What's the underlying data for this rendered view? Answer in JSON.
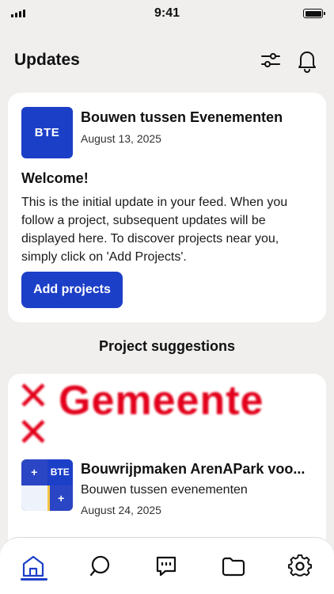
{
  "status_bar": {
    "time": "9:41"
  },
  "header": {
    "title": "Updates",
    "filter_icon": "sliders-icon",
    "bell_icon": "bell-icon"
  },
  "update": {
    "logo_text": "BTE",
    "author": "Bouwen tussen Evenementen",
    "date": "August 13, 2025",
    "heading": "Welcome!",
    "body": "This is the initial update in your feed. When you follow a project, subsequent updates will be displayed here. To discover projects near you, simply click on 'Add Projects'.",
    "button_label": "Add projects"
  },
  "suggestions": {
    "title": "Project suggestions",
    "items": [
      {
        "banner_text": "Gemeente",
        "title": "Bouwrijpmaken ArenAPark voo...",
        "organization": "Bouwen tussen evenementen",
        "date": "August 24, 2025",
        "logo_text": "BTE"
      }
    ]
  },
  "tabs": [
    {
      "icon": "home-icon",
      "active": true
    },
    {
      "icon": "search-icon",
      "active": false
    },
    {
      "icon": "chat-icon",
      "active": false
    },
    {
      "icon": "folder-icon",
      "active": false
    },
    {
      "icon": "gear-icon",
      "active": false
    }
  ],
  "colors": {
    "accent": "#1c3fc8",
    "background": "#f0efee",
    "brand_red": "#e3001b"
  }
}
